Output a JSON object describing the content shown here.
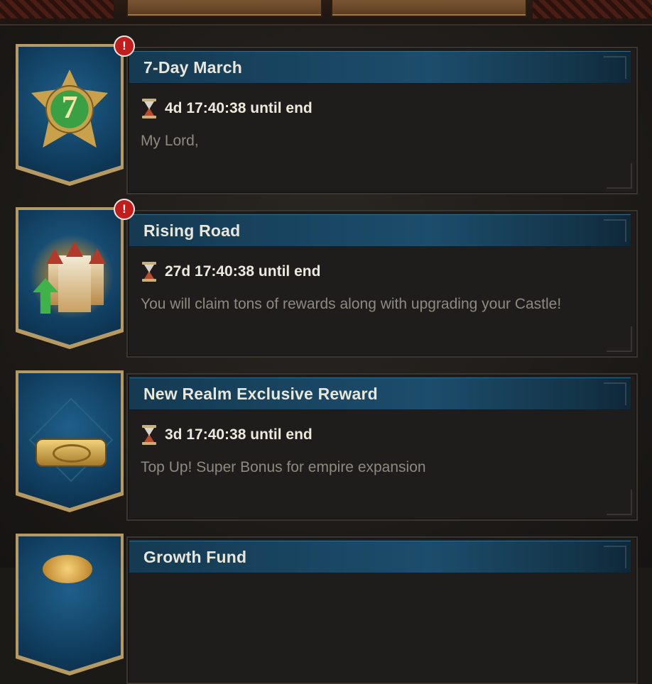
{
  "top_bar": {
    "tabs": [
      {
        "label": ""
      },
      {
        "label": ""
      }
    ]
  },
  "events": [
    {
      "title": "7-Day March",
      "timer": "4d 17:40:38 until end",
      "description": "My Lord,",
      "has_alert": true,
      "alert_symbol": "!",
      "icon": "medal-7-icon",
      "medal_number": "7"
    },
    {
      "title": "Rising Road",
      "timer": "27d 17:40:38 until end",
      "description": "You will claim tons of rewards along with upgrading your Castle!",
      "has_alert": true,
      "alert_symbol": "!",
      "icon": "castle-upgrade-icon"
    },
    {
      "title": "New Realm Exclusive Reward",
      "timer": "3d 17:40:38 until end",
      "description": "Top Up! Super Bonus for empire expansion",
      "has_alert": false,
      "icon": "crown-icon"
    },
    {
      "title": "Growth Fund",
      "timer": "",
      "description": "",
      "has_alert": false,
      "icon": "gold-coin-icon"
    }
  ],
  "colors": {
    "title_bar": "#1c4d6c",
    "banner": "#0f3a5a",
    "alert": "#c11d1d",
    "timer_text": "#ece9df",
    "description_text": "#8f8a80"
  }
}
